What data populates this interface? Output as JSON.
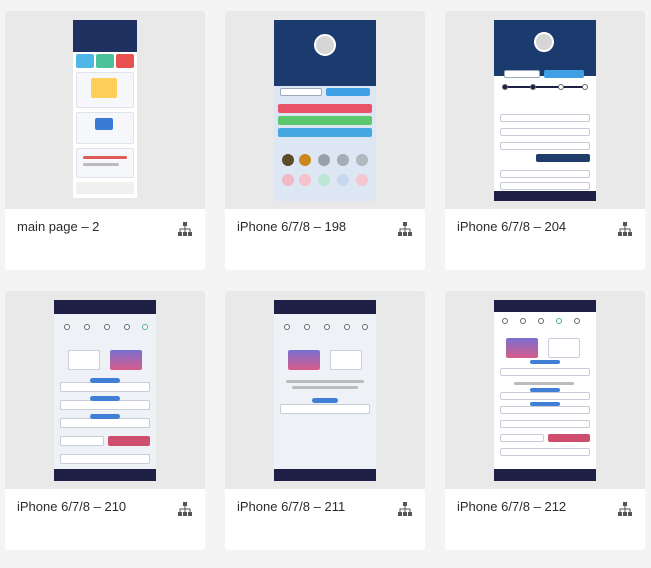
{
  "artboards": [
    {
      "name": "main page – 2",
      "icon": "share-network-icon"
    },
    {
      "name": "iPhone 6/7/8 – 198",
      "icon": "share-network-icon"
    },
    {
      "name": "iPhone 6/7/8 – 204",
      "icon": "share-network-icon"
    },
    {
      "name": "iPhone 6/7/8 – 210",
      "icon": "share-network-icon"
    },
    {
      "name": "iPhone 6/7/8 – 211",
      "icon": "share-network-icon"
    },
    {
      "name": "iPhone 6/7/8 – 212",
      "icon": "share-network-icon"
    }
  ]
}
